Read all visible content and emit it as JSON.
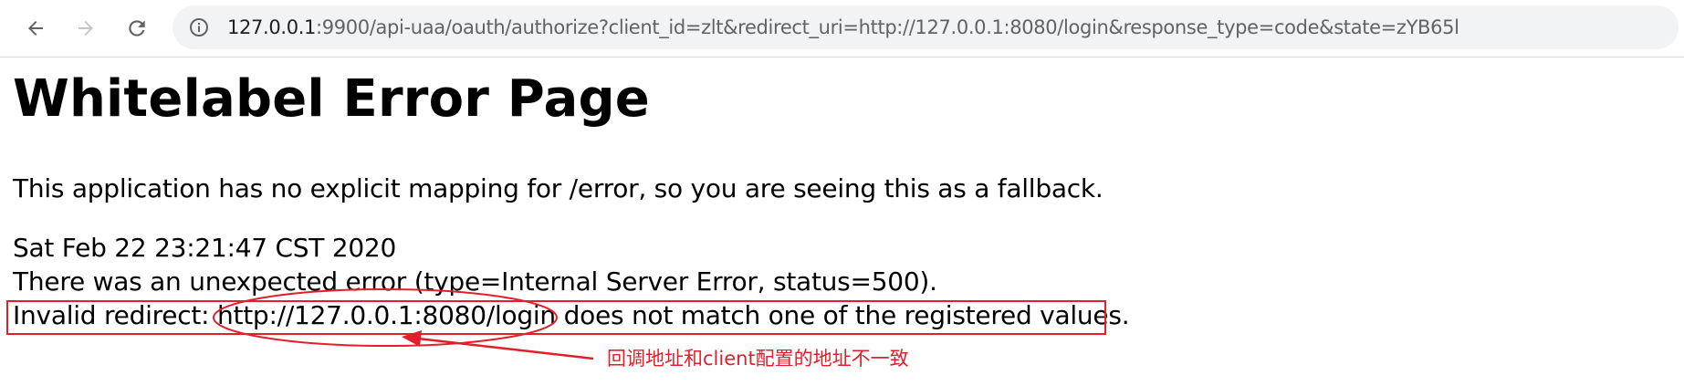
{
  "browser": {
    "url_host": "127.0.0.1",
    "url_rest": ":9900/api-uaa/oauth/authorize?client_id=zlt&redirect_uri=http://127.0.0.1:8080/login&response_type=code&state=zYB65l",
    "icons": {
      "back": "arrow-left-icon",
      "forward": "arrow-right-icon",
      "reload": "reload-icon",
      "site_info": "info-icon"
    }
  },
  "page": {
    "title": "Whitelabel Error Page",
    "description": "This application has no explicit mapping for /error, so you are seeing this as a fallback.",
    "timestamp": "Sat Feb 22 23:21:47 CST 2020",
    "error_line": "There was an unexpected error (type=Internal Server Error, status=500).",
    "invalid_redirect": "Invalid redirect: http://127.0.0.1:8080/login does not match one of the registered values."
  },
  "annotation": {
    "note": "回调地址和client配置的地址不一致",
    "color": "#e0202a"
  }
}
